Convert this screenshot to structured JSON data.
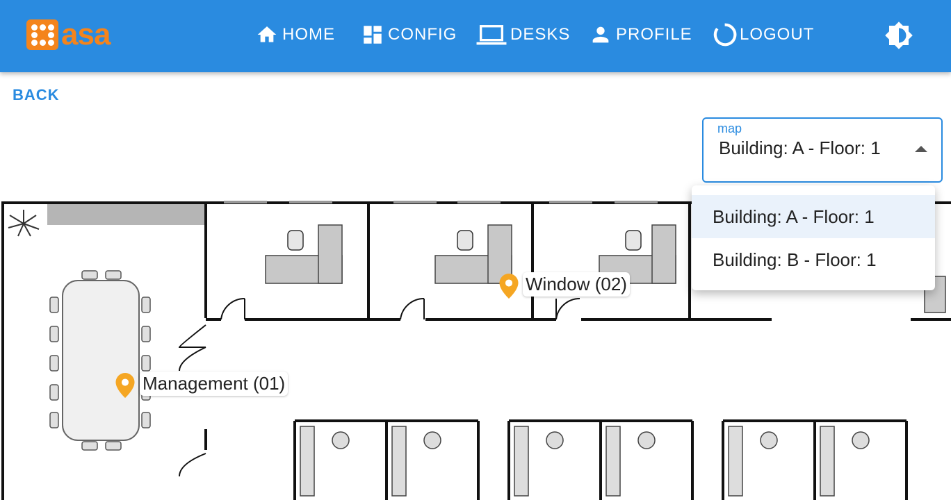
{
  "header": {
    "logo_text": "asa",
    "nav": [
      {
        "label": "HOME",
        "icon": "home-icon"
      },
      {
        "label": "CONFIG",
        "icon": "dashboard-icon"
      },
      {
        "label": "DESKS",
        "icon": "laptop-icon"
      },
      {
        "label": "PROFILE",
        "icon": "person-icon"
      },
      {
        "label": "LOGOUT",
        "icon": "logout-icon"
      }
    ],
    "theme_toggle_icon": "brightness-icon"
  },
  "back_label": "BACK",
  "map_select": {
    "label": "map",
    "value": "Building: A - Floor: 1",
    "options": [
      "Building: A - Floor: 1",
      "Building: B - Floor: 1"
    ]
  },
  "desks": [
    {
      "label": "Window (02)"
    },
    {
      "label": "Management (01)"
    }
  ],
  "colors": {
    "appbar": "#2a8be0",
    "logo": "#f4841c",
    "pin": "#f5a623",
    "selected_option": "#eaf2fb"
  }
}
